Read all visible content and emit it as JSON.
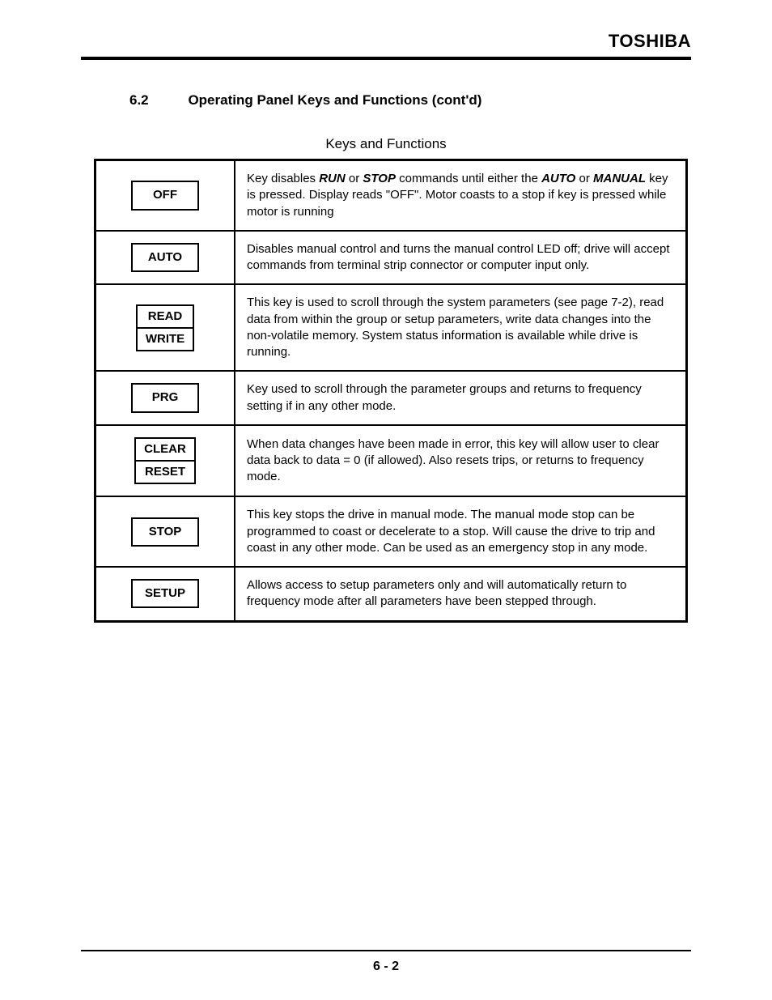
{
  "header": {
    "brand": "TOSHIBA",
    "section_number": "6.2",
    "section_title": "Operating Panel Keys and Functions (cont'd)",
    "table_caption": "Keys and Functions"
  },
  "rows": [
    {
      "key_lines": [
        "OFF"
      ],
      "desc_parts": [
        {
          "t": "Key disables "
        },
        {
          "t": "RUN",
          "bi": true
        },
        {
          "t": " or "
        },
        {
          "t": "STOP",
          "bi": true
        },
        {
          "t": " commands until either the "
        },
        {
          "t": "AUTO",
          "bi": true
        },
        {
          "t": " or "
        },
        {
          "t": "MANUAL",
          "bi": true
        },
        {
          "t": " key is pressed. Display reads \"OFF\". Motor coasts to a stop if key is pressed while motor is running"
        }
      ]
    },
    {
      "key_lines": [
        "AUTO"
      ],
      "desc_parts": [
        {
          "t": "Disables manual control and turns the manual control LED off; drive will accept commands from terminal strip connector or computer input only."
        }
      ]
    },
    {
      "key_lines": [
        "READ",
        "WRITE"
      ],
      "desc_parts": [
        {
          "t": "This key is used to scroll through the system parameters (see page 7-2), read data from within the group or setup parameters, write data changes into the non-volatile memory. System status information is available while drive is running."
        }
      ]
    },
    {
      "key_lines": [
        "PRG"
      ],
      "desc_parts": [
        {
          "t": "Key used to scroll through the parameter groups and returns to frequency setting if in any other mode."
        }
      ]
    },
    {
      "key_lines": [
        "CLEAR",
        "RESET"
      ],
      "desc_parts": [
        {
          "t": "When data changes have been made in error, this key will allow user to clear data back to data = 0 (if allowed). Also resets trips, or returns to frequency mode."
        }
      ]
    },
    {
      "key_lines": [
        "STOP"
      ],
      "desc_parts": [
        {
          "t": "This key stops the drive in manual mode. The manual mode stop can be programmed to coast or decelerate to a stop. Will cause the drive to trip and coast in any other mode. Can be used as an emergency stop in any mode."
        }
      ]
    },
    {
      "key_lines": [
        "SETUP"
      ],
      "desc_parts": [
        {
          "t": "Allows access to setup parameters only and will automatically return to frequency mode after all parameters have been stepped through."
        }
      ]
    }
  ],
  "page_number": "6 - 2"
}
